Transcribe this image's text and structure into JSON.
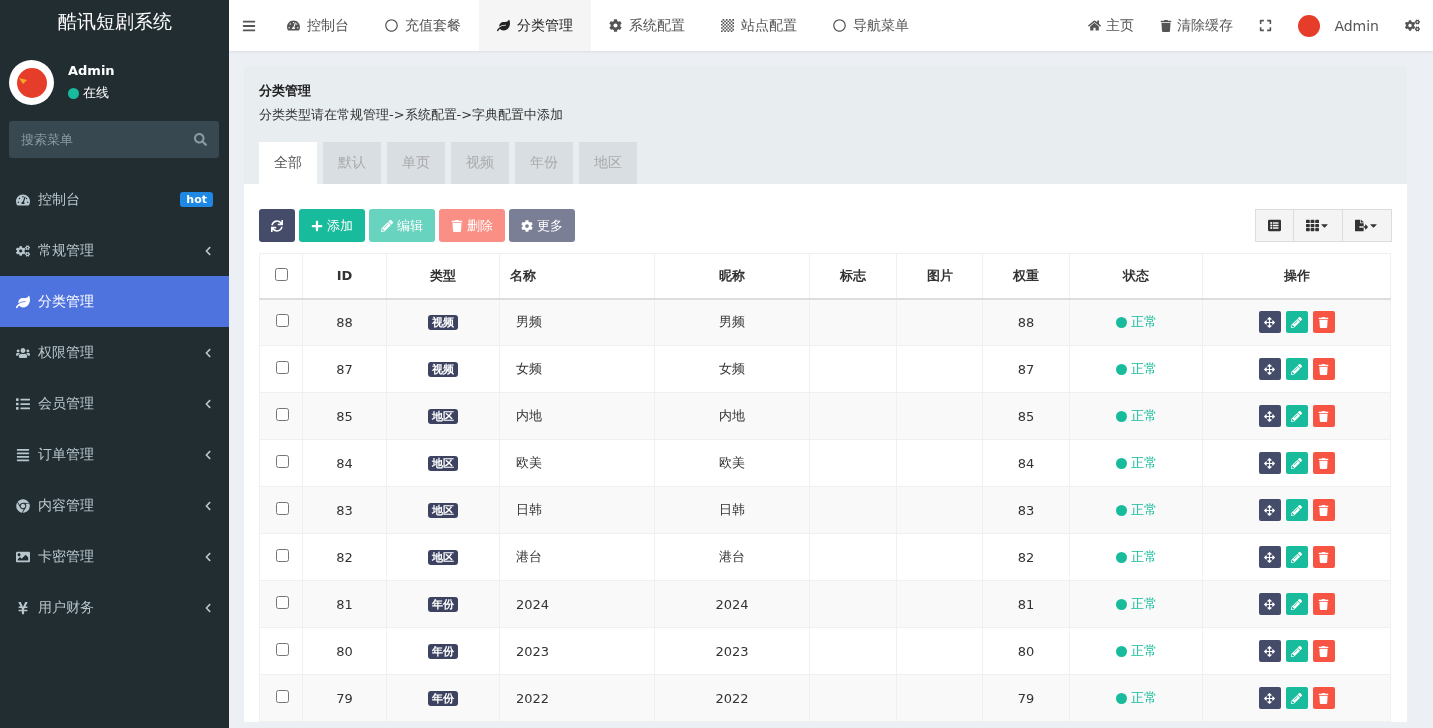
{
  "brand": "酷讯短剧系统",
  "user": {
    "name": "Admin",
    "status": "在线"
  },
  "search": {
    "placeholder": "搜索菜单"
  },
  "sidebar": {
    "items": [
      {
        "label": "控制台",
        "badge": "hot",
        "expandable": false,
        "selected": false
      },
      {
        "label": "常规管理",
        "expandable": true,
        "selected": false
      },
      {
        "label": "分类管理",
        "expandable": false,
        "selected": true
      },
      {
        "label": "权限管理",
        "expandable": true,
        "selected": false
      },
      {
        "label": "会员管理",
        "expandable": true,
        "selected": false
      },
      {
        "label": "订单管理",
        "expandable": true,
        "selected": false
      },
      {
        "label": "内容管理",
        "expandable": true,
        "selected": false
      },
      {
        "label": "卡密管理",
        "expandable": true,
        "selected": false
      },
      {
        "label": "用户财务",
        "expandable": true,
        "selected": false
      }
    ]
  },
  "top_tabs": [
    {
      "label": "控制台",
      "selected": false
    },
    {
      "label": "充值套餐",
      "selected": false
    },
    {
      "label": "分类管理",
      "selected": true
    },
    {
      "label": "系统配置",
      "selected": false
    },
    {
      "label": "站点配置",
      "selected": false
    },
    {
      "label": "导航菜单",
      "selected": false
    }
  ],
  "top_right": {
    "home": "主页",
    "clear_cache": "清除缓存",
    "user": "Admin"
  },
  "panel": {
    "title": "分类管理",
    "description": "分类类型请在常规管理->系统配置->字典配置中添加",
    "tabs": [
      {
        "label": "全部",
        "selected": true
      },
      {
        "label": "默认",
        "selected": false
      },
      {
        "label": "单页",
        "selected": false
      },
      {
        "label": "视频",
        "selected": false
      },
      {
        "label": "年份",
        "selected": false
      },
      {
        "label": "地区",
        "selected": false
      }
    ]
  },
  "toolbar": [
    {
      "kind": "refresh",
      "disabled": false
    },
    {
      "kind": "add",
      "label": "添加",
      "disabled": false
    },
    {
      "kind": "edit",
      "label": "编辑",
      "disabled": true
    },
    {
      "kind": "delete",
      "label": "删除",
      "disabled": true
    },
    {
      "kind": "more",
      "label": "更多",
      "disabled": false
    }
  ],
  "table": {
    "select_all_checked": false,
    "columns": [
      "ID",
      "类型",
      "名称",
      "昵称",
      "标志",
      "图片",
      "权重",
      "状态",
      "操作"
    ],
    "rows": [
      {
        "checked": false,
        "id": "88",
        "type": "视频",
        "name": "男频",
        "nickname": "男频",
        "weight": "88",
        "status": "正常",
        "color": "#18bc9c"
      },
      {
        "checked": false,
        "id": "87",
        "type": "视频",
        "name": "女频",
        "nickname": "女频",
        "weight": "87",
        "status": "正常",
        "color": "#18bc9c"
      },
      {
        "checked": false,
        "id": "85",
        "type": "地区",
        "name": "内地",
        "nickname": "内地",
        "weight": "85",
        "status": "正常",
        "color": "#18bc9c"
      },
      {
        "checked": false,
        "id": "84",
        "type": "地区",
        "name": "欧美",
        "nickname": "欧美",
        "weight": "84",
        "status": "正常",
        "color": "#18bc9c"
      },
      {
        "checked": false,
        "id": "83",
        "type": "地区",
        "name": "日韩",
        "nickname": "日韩",
        "weight": "83",
        "status": "正常",
        "color": "#18bc9c"
      },
      {
        "checked": false,
        "id": "82",
        "type": "地区",
        "name": "港台",
        "nickname": "港台",
        "weight": "82",
        "status": "正常",
        "color": "#18bc9c"
      },
      {
        "checked": false,
        "id": "81",
        "type": "年份",
        "name": "2024",
        "nickname": "2024",
        "weight": "81",
        "status": "正常",
        "color": "#18bc9c"
      },
      {
        "checked": false,
        "id": "80",
        "type": "年份",
        "name": "2023",
        "nickname": "2023",
        "weight": "80",
        "status": "正常",
        "color": "#18bc9c"
      },
      {
        "checked": false,
        "id": "79",
        "type": "年份",
        "name": "2022",
        "nickname": "2022",
        "weight": "79",
        "status": "正常",
        "color": "#18bc9c"
      }
    ]
  }
}
